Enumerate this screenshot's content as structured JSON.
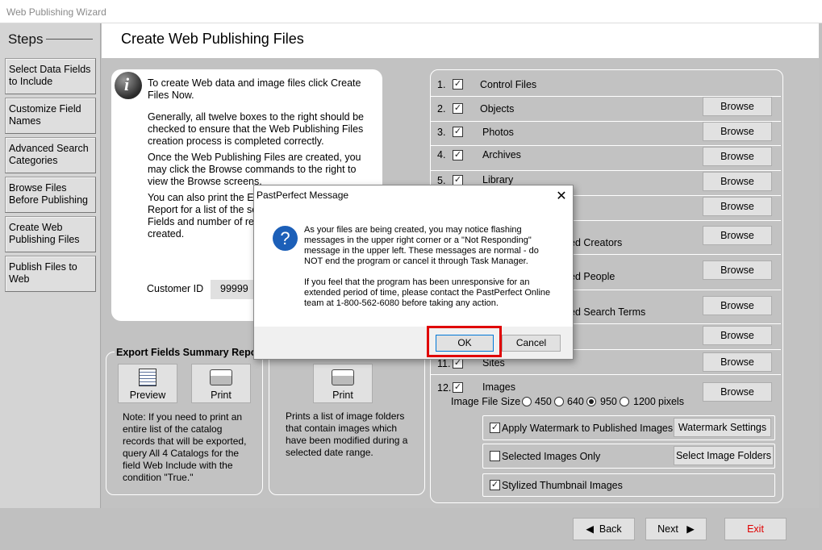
{
  "window": {
    "title": "Web Publishing Wizard"
  },
  "sidebar": {
    "title": "Steps",
    "items": [
      {
        "label": "Select Data Fields to Include"
      },
      {
        "label": "Customize Field Names"
      },
      {
        "label": "Advanced Search Categories"
      },
      {
        "label": "Browse Files Before Publishing"
      },
      {
        "label": "Create Web Publishing Files"
      },
      {
        "label": "Publish Files to Web"
      }
    ]
  },
  "header": {
    "title": "Create Web Publishing Files"
  },
  "info": {
    "p1": "To create Web data and image files click Create Files Now.",
    "p2": "Generally, all twelve boxes to the right should be checked to ensure that the Web Publishing Files creation process is completed correctly.",
    "p3": "Once the Web Publishing Files are created, you may click the Browse commands to the right to view the Browse screens.",
    "p4a": "You can also print the Ex",
    "p4b": "Report for a list of the se",
    "p4c": "Fields and number of re",
    "p4d": "created.",
    "customer_label": "Customer ID",
    "customer_value": "99999"
  },
  "export": {
    "title": "Export Fields Summary Report",
    "preview_label": "Preview",
    "print_label": "Print",
    "note": "Note: If you need to print an entire list of the catalog records that will be exported, query All 4 Catalogs for the field Web Include with the condition \"True.\""
  },
  "image_folders": {
    "print_label": "Print",
    "description": "Prints a list of image folders that contain images which have been modified during a selected date range."
  },
  "files": {
    "browse_label": "Browse",
    "rows": [
      {
        "num": "1.",
        "label": "Control Files"
      },
      {
        "num": "2.",
        "label": "Objects"
      },
      {
        "num": "3.",
        "label": "Photos"
      },
      {
        "num": "4.",
        "label": "Archives"
      },
      {
        "num": "5.",
        "label": "Library"
      },
      {
        "num": "",
        "label": ""
      },
      {
        "num": "",
        "label": "ed Creators"
      },
      {
        "num": "",
        "label": "ed People"
      },
      {
        "num": "",
        "label": "ed Search Terms"
      },
      {
        "num": "",
        "label": ""
      },
      {
        "num": "11.",
        "label": "Sites"
      },
      {
        "num": "12.",
        "label": "Images"
      }
    ],
    "image_size_label": "Image File Size",
    "sizes": [
      "450",
      "640",
      "950",
      "1200"
    ],
    "selected_size": "950",
    "pixels_label": "pixels",
    "watermark_label": "Apply Watermark to Published Images",
    "watermark_button": "Watermark Settings",
    "selected_only_label": "Selected Images Only",
    "select_folders_button": "Select Image Folders",
    "thumbnail_label": "Stylized Thumbnail Images"
  },
  "nav": {
    "back": "Back",
    "next": "Next",
    "exit": "Exit"
  },
  "dialog": {
    "title": "PastPerfect Message",
    "message1": "As your files are being created, you may notice flashing messages in the upper right corner or a \"Not Responding\" message in the upper left. These messages are normal - do NOT end the program or cancel it through Task Manager.",
    "message2": "If you feel that the program has been unresponsive for an extended period of time, please contact the PastPerfect Online team at 1-800-562-6080 before taking any action.",
    "ok": "OK",
    "cancel": "Cancel"
  },
  "colors": {
    "exit": "#e00000",
    "highlight": "#e00000",
    "dialog_icon": "#1c5fb8"
  }
}
